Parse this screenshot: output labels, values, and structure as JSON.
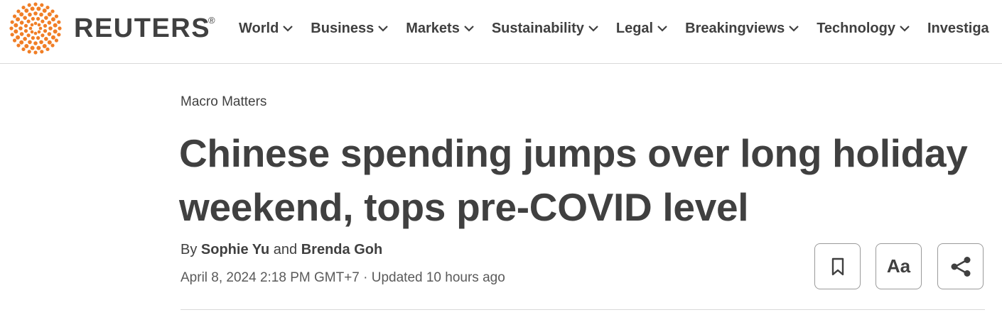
{
  "brand": {
    "name": "REUTERS",
    "registered_mark": "®",
    "accent_color": "#f07e26"
  },
  "nav": {
    "items": [
      {
        "label": "World"
      },
      {
        "label": "Business"
      },
      {
        "label": "Markets"
      },
      {
        "label": "Sustainability"
      },
      {
        "label": "Legal"
      },
      {
        "label": "Breakingviews"
      },
      {
        "label": "Technology"
      },
      {
        "label": "Investiga"
      }
    ],
    "chevron_icon": "chevron-down-icon"
  },
  "article": {
    "kicker": "Macro Matters",
    "headline": "Chinese spending jumps over long holiday weekend, tops pre-COVID level",
    "byline": {
      "prefix": "By",
      "author1": "Sophie Yu",
      "conjunction": "and",
      "author2": "Brenda Goh"
    },
    "dateline": "April 8, 2024 2:18 PM GMT+7 · Updated 10 hours ago"
  },
  "tools": {
    "save_icon": "bookmark-icon",
    "text_size_label": "Aa",
    "share_icon": "share-icon"
  },
  "colors": {
    "text": "#404040",
    "border": "#9a9a9a",
    "divider": "#d9d9d9"
  }
}
